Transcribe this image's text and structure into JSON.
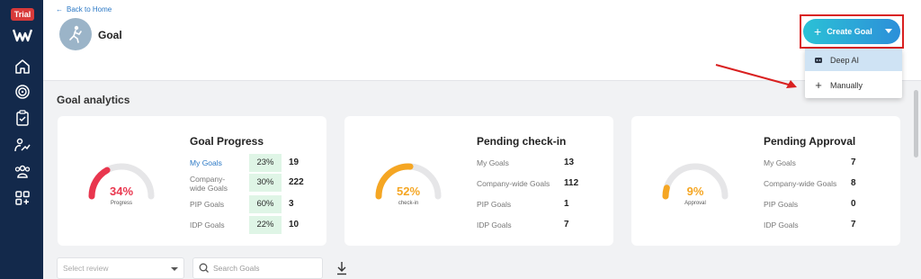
{
  "sidebar": {
    "trial_badge": "Trial",
    "icons": [
      "logo-icon",
      "home-icon",
      "target-icon",
      "clipboard-icon",
      "growth-icon",
      "team-icon",
      "apps-icon"
    ]
  },
  "header": {
    "back_label": "Back to Home",
    "title": "Goal",
    "create_button": "Create Goal",
    "dropdown": [
      {
        "label": "Deep AI",
        "icon": "robot-icon"
      },
      {
        "label": "Manually",
        "icon": "plus-icon"
      }
    ]
  },
  "analytics": {
    "section_title": "Goal analytics",
    "cards": [
      {
        "title": "Goal Progress",
        "gauge": {
          "value": "34%",
          "label": "Progress",
          "fraction": 0.34,
          "color": "#e9364e"
        },
        "rows": [
          {
            "label": "My Goals",
            "pct": "23%",
            "count": "19"
          },
          {
            "label": "Company-wide Goals",
            "pct": "30%",
            "count": "222"
          },
          {
            "label": "PIP Goals",
            "pct": "60%",
            "count": "3"
          },
          {
            "label": "IDP Goals",
            "pct": "22%",
            "count": "10"
          }
        ]
      },
      {
        "title": "Pending check-in",
        "gauge": {
          "value": "52%",
          "label": "check-in",
          "fraction": 0.52,
          "color": "#f5a623"
        },
        "rows": [
          {
            "label": "My Goals",
            "count": "13"
          },
          {
            "label": "Company-wide Goals",
            "count": "112"
          },
          {
            "label": "PIP Goals",
            "count": "1"
          },
          {
            "label": "IDP Goals",
            "count": "7"
          }
        ]
      },
      {
        "title": "Pending Approval",
        "gauge": {
          "value": "9%",
          "label": "Approval",
          "fraction": 0.09,
          "color": "#f5a623"
        },
        "rows": [
          {
            "label": "My Goals",
            "count": "7"
          },
          {
            "label": "Company-wide Goals",
            "count": "8"
          },
          {
            "label": "PIP Goals",
            "count": "0"
          },
          {
            "label": "IDP Goals",
            "count": "7"
          }
        ]
      }
    ]
  },
  "controls": {
    "select_review_placeholder": "Select review",
    "search_placeholder": "Search Goals"
  },
  "colors": {
    "sidebar": "#13294b",
    "accent": "#2b78c5",
    "highlight": "#d92020"
  }
}
